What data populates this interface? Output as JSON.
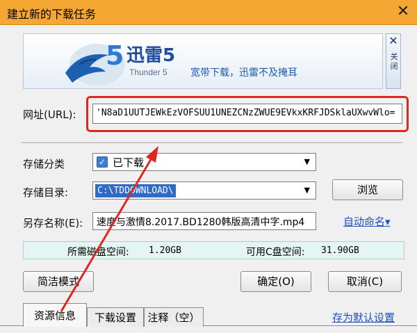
{
  "window": {
    "title": "建立新的下载任务",
    "close_glyph": "✕"
  },
  "banner": {
    "brand": "迅雷5",
    "subtitle": "Thunder 5",
    "slogan": "宽带下载，迅雷不及掩耳",
    "side_close_glyph": "✕",
    "side_close_label": "关闭"
  },
  "form": {
    "url_label": "网址(URL):",
    "url_value": "'N8aD1UUTJEWkEzVOFSUU1UNEZCNzZWUE9EVkxKRFJDSklaUXwvWlo=",
    "category_label": "存储分类",
    "category_value": "已下载",
    "directory_label": "存储目录:",
    "directory_value": "C:\\TDDOWNLOAD\\",
    "browse_label": "浏览",
    "save_as_label": "另存名称(E):",
    "save_as_value": "速度与激情8.2017.BD1280韩版高清中字.mp4",
    "auto_name_label": "自动命名▾"
  },
  "space": {
    "required_label": "所需磁盘空间:",
    "required_value": "1.20GB",
    "available_label": "可用C盘空间:",
    "available_value": "31.90GB"
  },
  "buttons": {
    "simple_mode": "简洁模式",
    "ok": "确定(O)",
    "cancel": "取消(C)"
  },
  "tabs": [
    "资源信息",
    "下载设置",
    "注释（空）"
  ],
  "save_default": "存为默认设置",
  "colors": {
    "titlebar": "#f4a833",
    "highlight": "#e0271f",
    "link": "#1e50b8"
  },
  "icons": [
    "checkbox-checked-icon",
    "dropdown-arrow-icon",
    "thunder-logo-icon",
    "close-icon"
  ]
}
